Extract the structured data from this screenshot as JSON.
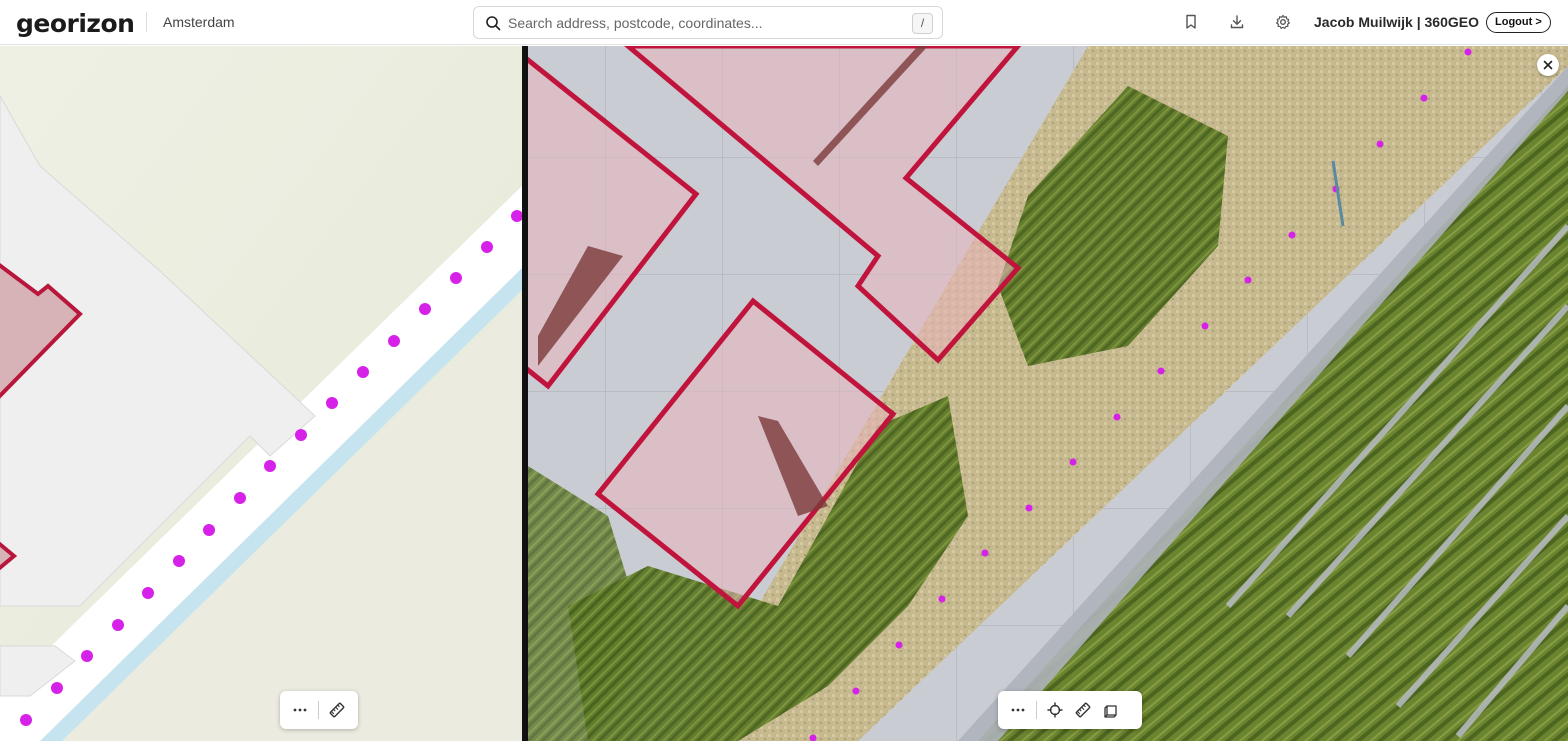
{
  "header": {
    "logo": "georizon",
    "city": "Amsterdam",
    "search_placeholder": "Search address, postcode, coordinates...",
    "search_shortcut": "/",
    "user": "Jacob Muilwijk | 360GEO",
    "logout_label": "Logout >"
  },
  "icons": {
    "search": "search-icon",
    "bookmark": "bookmark-icon",
    "download": "download-icon",
    "settings": "gear-icon",
    "close": "close-icon",
    "more": "more-icon",
    "measure": "ruler-icon",
    "locate": "crosshair-icon",
    "box": "cube-icon"
  },
  "colors": {
    "building_outline": "#c0143c",
    "building_fill": "#e8b4bd",
    "track_point": "#d622e8",
    "map_background": "#eef0e6",
    "water": "#bfe2f2"
  },
  "map_left": {
    "toolbar": [
      "more",
      "measure"
    ]
  },
  "view_right": {
    "toolbar": [
      "more",
      "locate",
      "measure",
      "box"
    ]
  }
}
